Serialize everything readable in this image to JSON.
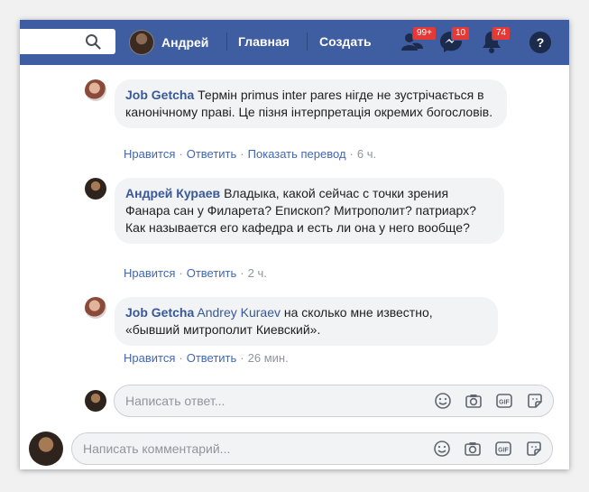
{
  "topbar": {
    "user_name": "Андрей",
    "nav_home": "Главная",
    "nav_create": "Создать",
    "friends_badge": "99+",
    "messages_badge": "10",
    "notifications_badge": "74",
    "help": "?"
  },
  "comments": [
    {
      "author": "Job Getcha",
      "text": "Термін primus inter pares нігде не зустрічається в канонічному праві. Це пізня інтерпретація окремих богословів.",
      "actions": {
        "like": "Нравится",
        "reply": "Ответить",
        "translate": "Показать перевод",
        "time": "6 ч."
      }
    },
    {
      "author": "Андрей Кураев",
      "text": "Владыка, какой сейчас с точки зрения Фанара сан у Филарета? Епископ? Митрополит? патриарх? Как называется его кафедра и есть ли она у него вообще?",
      "actions": {
        "like": "Нравится",
        "reply": "Ответить",
        "time": "2 ч."
      }
    },
    {
      "author": "Job Getcha",
      "mention": "Andrey Kuraev",
      "text": "на сколько мне известно, «бывший митрополит Киевский».",
      "actions": {
        "like": "Нравится",
        "reply": "Ответить",
        "time": "26 мин."
      }
    }
  ],
  "reply_input": {
    "placeholder": "Написать ответ..."
  },
  "comment_input": {
    "placeholder": "Написать комментарий..."
  },
  "colors": {
    "header": "#3f5ea2",
    "link": "#385898",
    "badge": "#e53935"
  }
}
